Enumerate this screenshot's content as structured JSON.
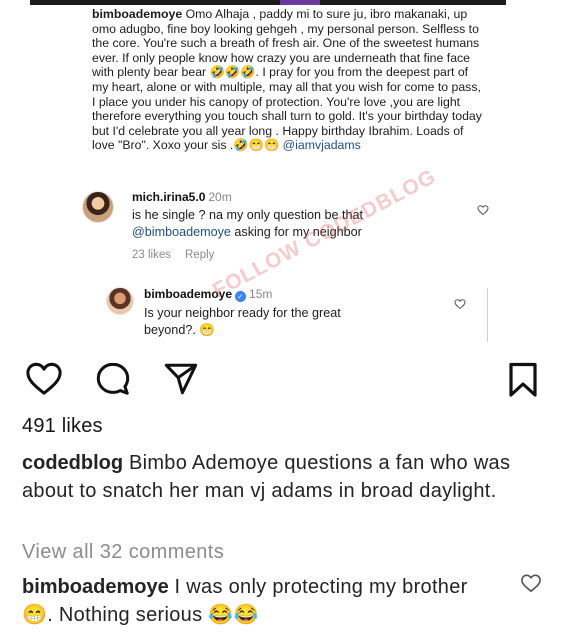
{
  "embedded": {
    "caption": {
      "username": "bimboademoye",
      "text": " Omo Alhaja , paddy mi to sure ju, ibro makanaki, up omo adugbo, fine boy looking gehgeh , my personal person. Selfless to the core. You're such a breath of fresh air. One of the sweetest humans ever. If only people know how crazy you are underneath that fine face with plenty bear bear 🤣🤣🤣. I pray for you from the deepest part of my heart,  alone or with multiple,  may all that you wish for come to pass, I place you under his canopy of protection. You're love ,you are light therefore everything you touch shall turn  to gold. It's your birthday today but I'd celebrate you all year long . Happy birthday Ibrahim. Loads of love \"Bro\". Xoxo your sis .🤣😁😁 ",
      "mention": "@iamvjadams"
    },
    "comment1": {
      "username": "mich.irina5.0",
      "time": "20m",
      "text": "is he single ? na my only question be that ",
      "mention": "@bimboademoye",
      "text_after": "  asking for my neighbor",
      "likes": "23 likes",
      "reply": "Reply"
    },
    "comment2": {
      "username": "bimboademoye",
      "verified": "✓",
      "time": "15m",
      "text": "Is your neighbor ready for the great beyond?. 😁"
    },
    "watermark": "FOLLOW CODEDBLOG"
  },
  "actions": {
    "like_icon": "heart-outline-icon",
    "comment_icon": "speech-bubble-icon",
    "share_icon": "paper-plane-icon",
    "save_icon": "bookmark-icon"
  },
  "likes_count": "491 likes",
  "caption": {
    "username": "codedblog",
    "text": " Bimbo Ademoye questions a fan who was about to snatch her man vj adams in broad daylight."
  },
  "view_all_comments": "View all 32 comments",
  "top_comment": {
    "username": "bimboademoye",
    "text": " I was only protecting my brother 😁. Nothing serious 😂😂"
  },
  "colors": {
    "mention": "#1f4e8c",
    "muted": "#8c8c8c",
    "verified": "#3b82f6"
  }
}
